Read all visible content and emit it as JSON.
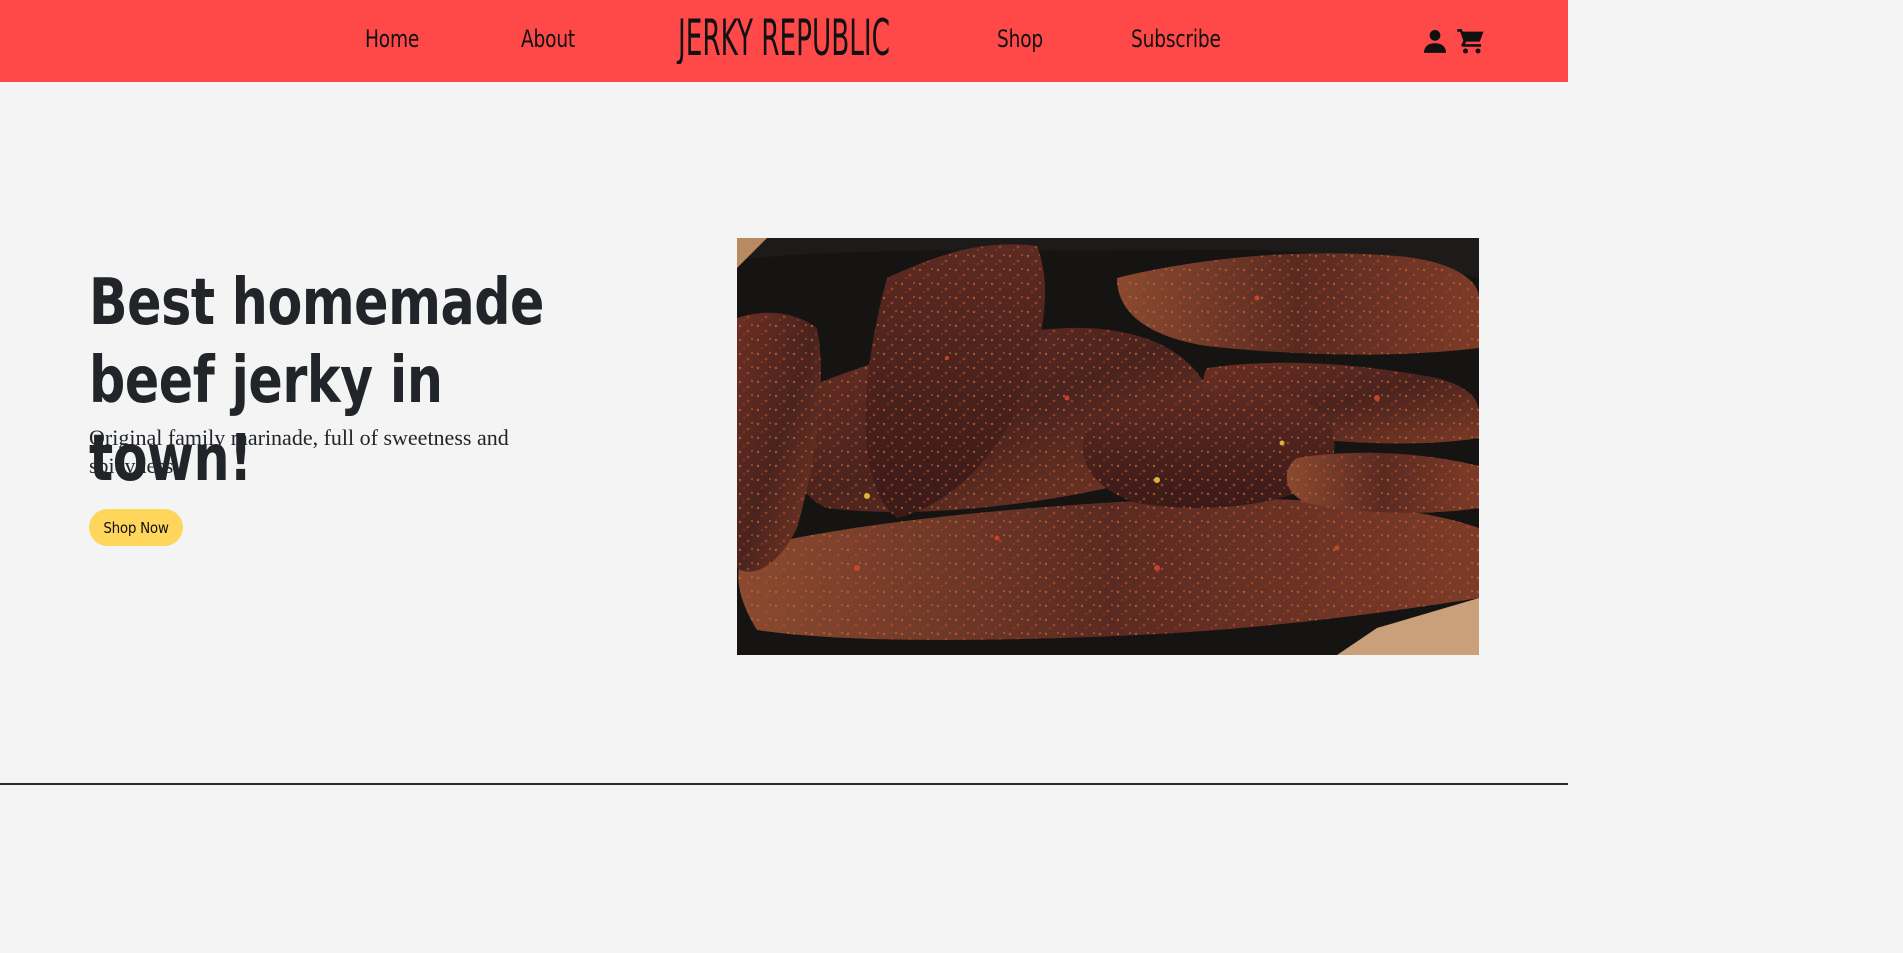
{
  "nav": {
    "links": [
      {
        "label": "Home"
      },
      {
        "label": "About"
      },
      {
        "label": "Shop"
      },
      {
        "label": "Subscribe"
      }
    ],
    "logo_text": "JERKY REPUBLIC",
    "icons": [
      "user-icon",
      "cart-icon"
    ]
  },
  "hero": {
    "title_line1": "Best homemade",
    "title_line2": "beef jerky in town!",
    "subtitle": "Original family marinade, full of sweetness and spicyness",
    "cta_label": "Shop Now"
  },
  "colors": {
    "navbar": "#ff4848",
    "background": "#f4f4f4",
    "button": "#ffd65c",
    "text": "#212529"
  }
}
